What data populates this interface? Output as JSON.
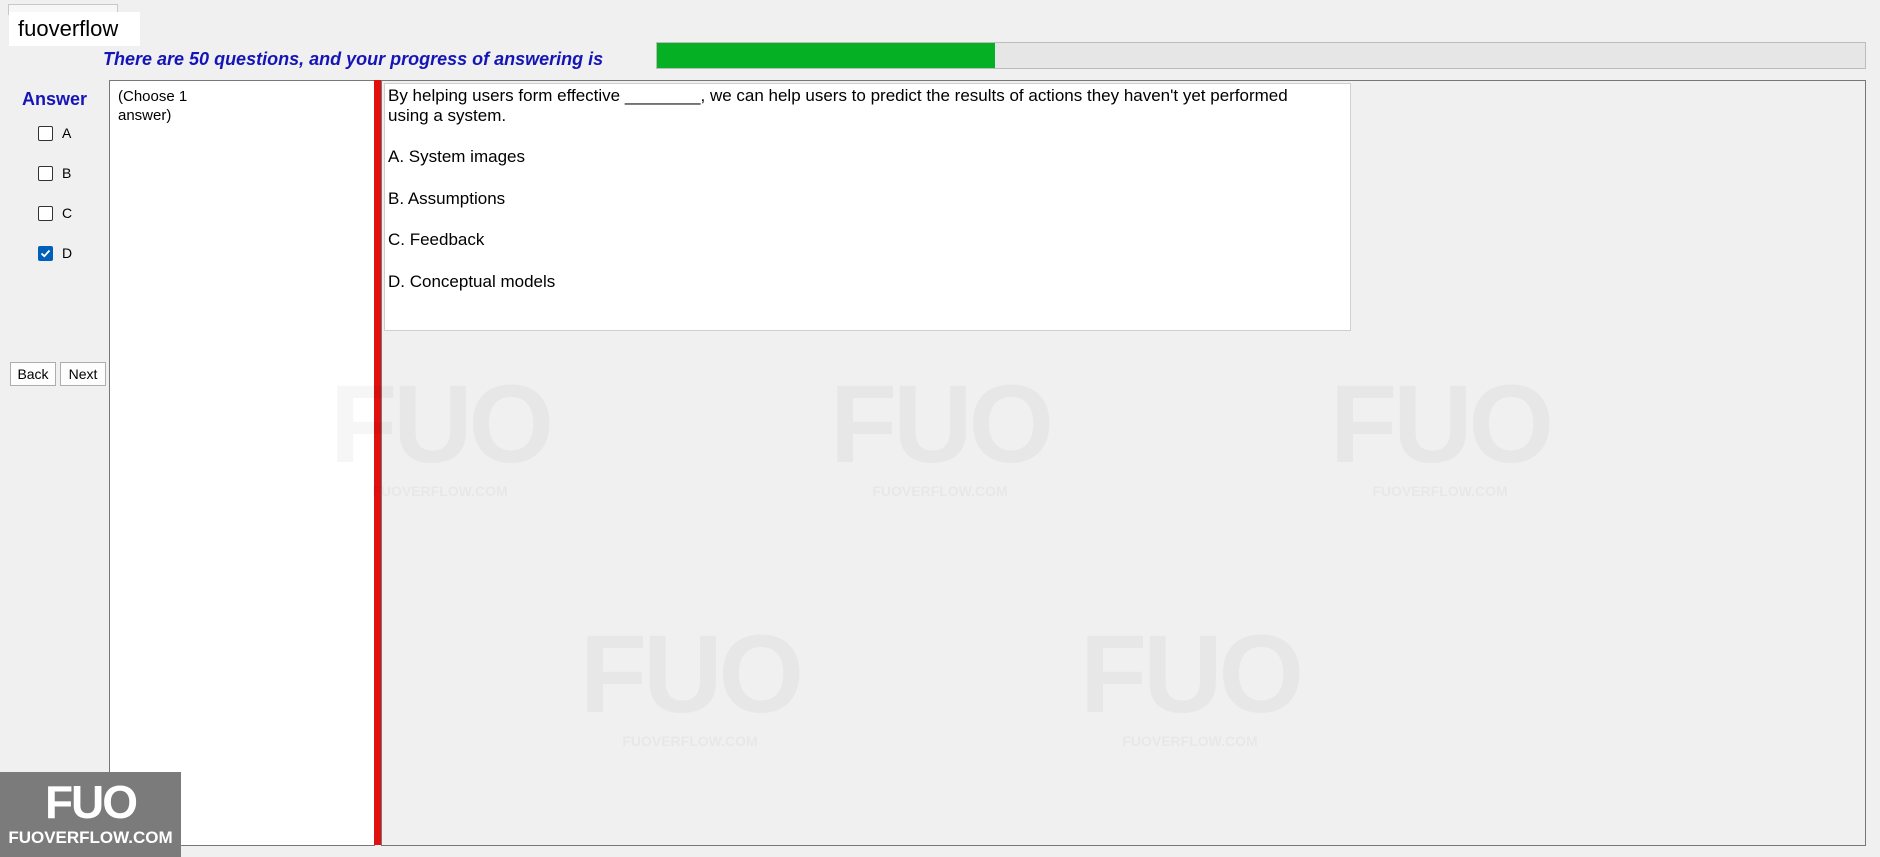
{
  "brand": "fuoverflow",
  "progress": {
    "label": "There are 50 questions, and your progress of answering is",
    "fraction": 0.28,
    "fill_color": "#06b025"
  },
  "answer": {
    "title": "Answer",
    "options": [
      {
        "letter": "A",
        "checked": false
      },
      {
        "letter": "B",
        "checked": false
      },
      {
        "letter": "C",
        "checked": false
      },
      {
        "letter": "D",
        "checked": true
      }
    ]
  },
  "nav": {
    "back_label": "Back",
    "next_label": "Next"
  },
  "hint": "(Choose 1 answer)",
  "question": {
    "text": "By helping users form effective ________, we can help users to predict the results of actions they haven't yet performed using a system.",
    "choices": [
      {
        "label": "A.  System images"
      },
      {
        "label": "B.  Assumptions"
      },
      {
        "label": "C.  Feedback"
      },
      {
        "label": "D.  Conceptual models"
      }
    ]
  },
  "watermark": {
    "mark": "FUO",
    "text": "FUOVERFLOW.COM"
  },
  "logo": {
    "mark": "FUO",
    "text": "FUOVERFLOW.COM"
  },
  "colors": {
    "accent_blue": "#1414b8",
    "divider_red": "#e01010",
    "check_blue": "#005fb8"
  }
}
